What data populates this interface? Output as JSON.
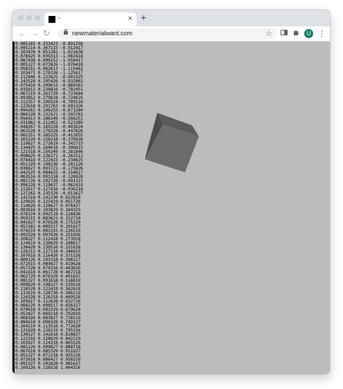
{
  "browser": {
    "tab": {
      "title": "-",
      "favicon_icon": "black-square-favicon",
      "close_label": "×"
    },
    "new_tab_label": "+",
    "nav": {
      "back": "←",
      "forward": "→",
      "reload": "↻"
    },
    "address": {
      "url": "newmaterialwant.com"
    },
    "bookmark_star": "☆",
    "toolbar_icons": [
      "reading-list-icon",
      "extensions-icon"
    ],
    "profile_initial": "U",
    "menu": "⋮"
  },
  "page": {
    "coordinate_lines": [
      "0.085165 0.333423 -0.891256",
      "0.095214 0.367115 -0.912417",
      "0.103476 0.051281 -1.021636",
      "0.076625 0.039313 -1.062418",
      "0.087436 0.009152 -1.059417",
      "0.005127 0.073826 -1.076418",
      "0.058251 0.062613 -1.115462",
      "0.103471 0.178326 -1.125617",
      "0.112046 0.133625 -0.901325",
      "0.143529 0.195426 -0.932862",
      "0.075416 0.209615 -0.860263",
      "0.035812 0.238816 -0.782451",
      "0.067219 0.261729 -0.723684",
      "0.093852 0.279618 -0.724625",
      "0.112357 0.299324 -0.705516",
      "0.122618 0.291763 -0.691326",
      "0.094262 0.196253 -0.671284",
      "0.084128 0.132521 -0.593762",
      "0.056913 0.186249 -0.566251",
      "0.031862 0.212452 -0.521385",
      "0.048267 0.169228 -0.491624",
      "0.063528 0.176528 -0.447826",
      "0.082351 0.185225 -0.412655",
      "0.101526 0.156218 -0.376926",
      "0.119627 0.172619 -0.342715",
      "0.134425 0.164618 -0.306815",
      "0.121518 0.150249 -0.281946",
      "0.098625 0.136271 -0.262512",
      "0.076418 0.122415 -0.234625",
      "0.051329 0.108236 -0.201126",
      "0.036627 0.093721 -0.175826",
      "0.042525 0.084625 -0.154617",
      "0.063516 0.093318 -0.126928",
      "0.081726 0.102726 -0.091315",
      "0.096228 0.119637 -0.062418",
      "0.112617 0.127416 -0.036218",
      "0.127262 0.135328 -0.011627",
      "0.141518 0.141236 0.022618",
      "0.129635 0.125419 0.051726",
      "0.114826 0.118627 0.076427",
      "0.093616 0.103829 0.104329",
      "0.076224 0.092518 0.126836",
      "0.059215 0.083621 0.152718",
      "0.041627 0.076528 0.175329",
      "0.053182 0.069317 0.201627",
      "0.074219 0.082315 0.226519",
      "0.092528 0.097626 0.251836",
      "0.108327 0.112418 0.273928",
      "0.124619 0.126629 0.296617",
      "0.138428 0.139516 0.321628",
      "0.126213 0.127218 0.346925",
      "0.107618 0.116426 0.371526",
      "0.089126 0.103318 0.396217",
      "0.072915 0.089627 0.419628",
      "0.057328 0.074316 0.443626",
      "0.041618 0.061728 0.467218",
      "0.062729 0.076329 0.491637",
      "0.081327 0.091618 0.516819",
      "0.099628 0.108227 0.539216",
      "0.116528 0.123419 0.562618",
      "0.132619 0.138726 0.586219",
      "0.124328 0.126318 0.609528",
      "0.105617 0.112628 0.632716",
      "0.088229 0.098517 0.656327",
      "0.070618 0.083329 0.679628",
      "0.053427 0.069218 0.702816",
      "0.068326 0.083627 0.726519",
      "0.086618 0.098328 0.749127",
      "0.104219 0.113516 0.772628",
      "0.121628 0.128219 0.795316",
      "0.136527 0.142618 0.818827",
      "0.122316 0.128629 0.842219",
      "0.103827 0.114318 0.865526",
      "0.085126 0.099627 0.888718",
      "0.067618 0.085329 0.911627",
      "0.051327 0.071218 0.935216",
      "0.072618 0.086427 0.958319",
      "0.091327 0.101628 0.981627",
      "0.109226 0.116528 1.004316"
    ],
    "cube_icon": "rotating-3d-cube"
  }
}
